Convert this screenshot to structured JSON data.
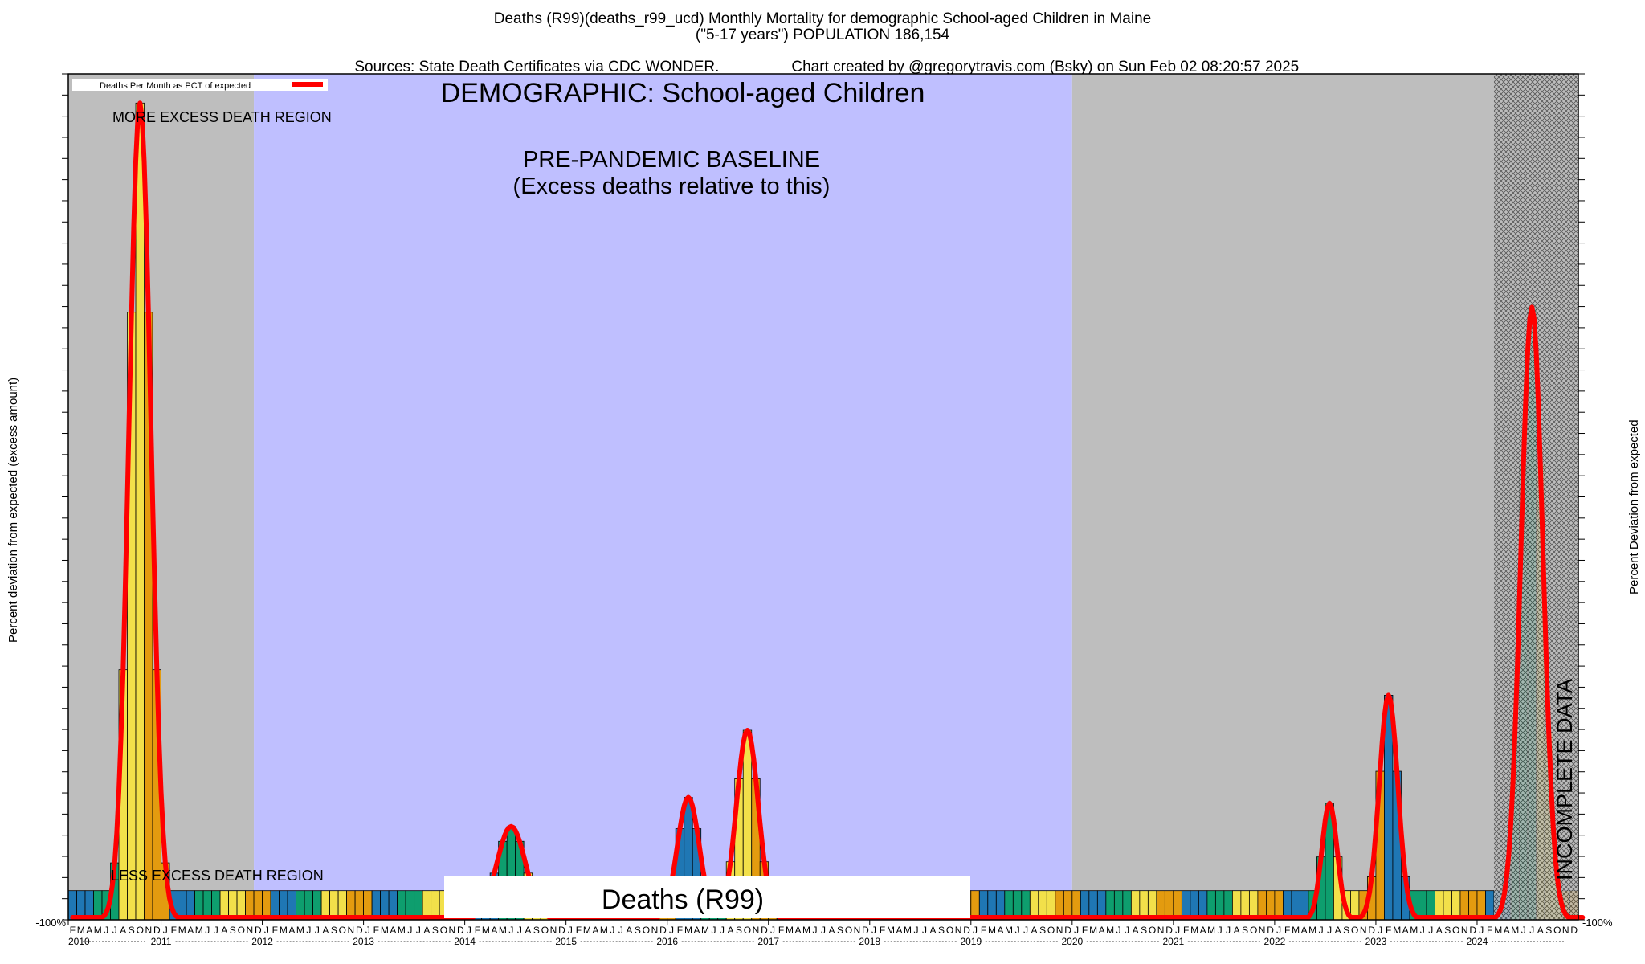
{
  "header": {
    "title_line1": "Deaths (R99)(deaths_r99_ucd) Monthly Mortality for demographic School-aged Children in Maine",
    "title_line2": "(\"5-17 years\") POPULATION 186,154",
    "sources": "Sources: State Death Certificates via CDC WONDER.",
    "credit": "Chart created by @gregorytravis.com (Bsky) on Sun Feb 02 08:20:57 2025"
  },
  "annotations": {
    "demographic": "DEMOGRAPHIC: School-aged Children",
    "baseline_line1": "PRE-PANDEMIC BASELINE",
    "baseline_line2": "(Excess deaths relative to this)",
    "more_region": "MORE EXCESS DEATH REGION",
    "less_region": "LESS EXCESS DEATH REGION",
    "incomplete": "INCOMPLETE DATA",
    "cause_box": "Deaths (R99)"
  },
  "legend": {
    "label": "Deaths Per Month as PCT of expected"
  },
  "colors": {
    "baseline_region": "#bfbfff",
    "other_region": "#bebebe",
    "curve": "#ff0000",
    "bar_palette": [
      "#1f77b4",
      "#0e9e6e",
      "#f2e04a",
      "#e39b0f"
    ]
  },
  "chart_data": {
    "type": "bar",
    "ylabel_left": "Percent deviation from expected (excess amount)",
    "ylabel_right": "Percent Deviation from expected",
    "ytick_bottom_label": "-100%",
    "x_start": "2010-02",
    "x_end": "2024-12",
    "years": [
      "2010",
      "2011",
      "2012",
      "2013",
      "2014",
      "2015",
      "2016",
      "2017",
      "2018",
      "2019",
      "2020",
      "2021",
      "2022",
      "2023",
      "2024"
    ],
    "month_letters": [
      "F",
      "M",
      "A",
      "M",
      "J",
      "J",
      "A",
      "S",
      "O",
      "N",
      "D",
      "J",
      "F",
      "M",
      "A",
      "M",
      "J",
      "J",
      "A",
      "S",
      "O",
      "N",
      "D"
    ],
    "baseline_period": [
      "2011-12",
      "2019-12"
    ],
    "incomplete_period": [
      "2024-03",
      "2024-12"
    ],
    "series": [
      {
        "name": "Deaths Per Month as PCT of expected",
        "peaks": [
          {
            "center": "2010-10",
            "value": 2700,
            "width_months": 1.3
          },
          {
            "center": "2014-06",
            "value": 220,
            "width_months": 1.7
          },
          {
            "center": "2016-03",
            "value": 320,
            "width_months": 1.3
          },
          {
            "center": "2016-10",
            "value": 550,
            "width_months": 1.3
          },
          {
            "center": "2022-07",
            "value": 300,
            "width_months": 0.9
          },
          {
            "center": "2023-02",
            "value": 670,
            "width_months": 1.1
          },
          {
            "center": "2024-07",
            "value": 2000,
            "width_months": 1.3
          }
        ]
      }
    ]
  }
}
